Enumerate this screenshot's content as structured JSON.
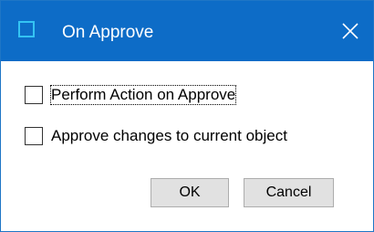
{
  "window": {
    "title": "On Approve",
    "close_icon": "close-icon",
    "accent_color": "#0d6cc7"
  },
  "options": [
    {
      "label": "Perform Action on Approve",
      "checked": false
    },
    {
      "label": "Approve changes to current object",
      "checked": false
    }
  ],
  "buttons": {
    "ok_label": "OK",
    "cancel_label": "Cancel"
  }
}
